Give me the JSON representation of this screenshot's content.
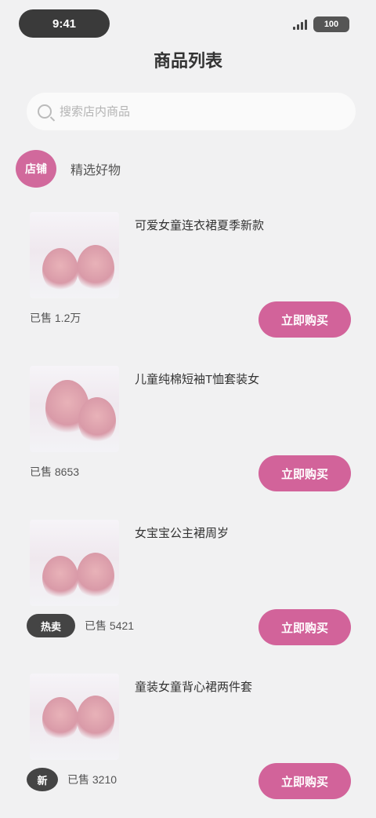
{
  "status_bar": {
    "time": "9:41",
    "battery": "100"
  },
  "header": {
    "title": "商品列表"
  },
  "search": {
    "placeholder": "搜索店内商品"
  },
  "store": {
    "avatar_text": "店铺",
    "name": "精选好物"
  },
  "products": [
    {
      "name": "可爱女童连衣裙夏季新款",
      "sales_tag": "",
      "sales_text": "已售 1.2万",
      "buy_label": "立即购买"
    },
    {
      "name": "儿童纯棉短袖T恤套装女",
      "sales_tag": "",
      "sales_text": "已售 8653",
      "buy_label": "立即购买"
    },
    {
      "name": "女宝宝公主裙周岁",
      "sales_tag": "热卖",
      "sales_text": "已售 5421",
      "buy_label": "立即购买"
    },
    {
      "name": "童装女童背心裙两件套",
      "sales_tag": "新",
      "sales_text": "已售 3210",
      "buy_label": "立即购买"
    }
  ],
  "colors": {
    "accent": "#d2639a",
    "background": "#f1f1f2"
  }
}
